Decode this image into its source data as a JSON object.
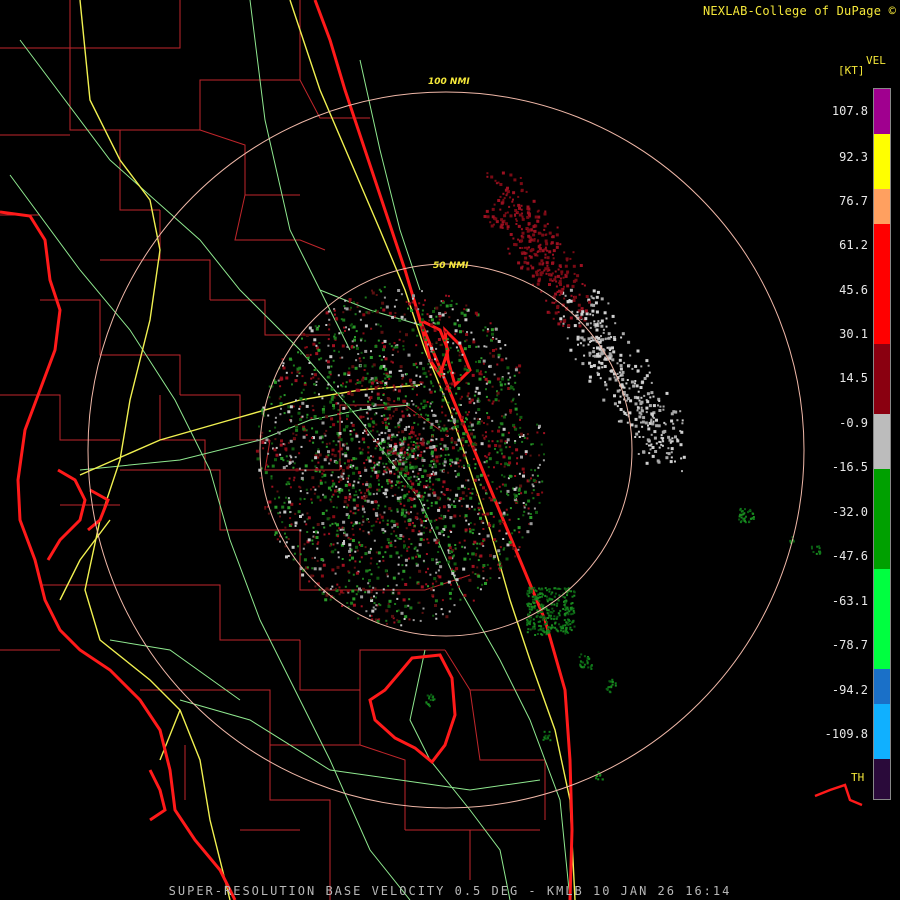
{
  "header": {
    "credit": "NEXLAB-College of DuPage ©"
  },
  "map": {
    "range_rings": [
      {
        "label": "100 NMI"
      },
      {
        "label": "50 NMI"
      }
    ],
    "colors": {
      "background": "#000000",
      "coastline": "#ff1a1a",
      "county_lines": "#c0262b",
      "interstates": "#f0f050",
      "highways": "#8fe88f",
      "range_rings": "#f0b8a8"
    }
  },
  "legend": {
    "product": "VEL",
    "unit": "[KT]",
    "ticks": [
      "107.8",
      "92.3",
      "76.7",
      "61.2",
      "45.6",
      "30.1",
      "14.5",
      "-0.9",
      "-16.5",
      "-32.0",
      "-47.6",
      "-63.1",
      "-78.7",
      "-94.2",
      "-109.8"
    ],
    "threshold_label": "TH",
    "colors": [
      "#a0008f",
      "#ffff00",
      "#ffa060",
      "#ff0000",
      "#8a0010",
      "#bcbcbc",
      "#00a000",
      "#00ff40",
      "#1a70c8",
      "#10b0ff",
      "#2a0a3a"
    ]
  },
  "footer": {
    "caption": "SUPER-RESOLUTION BASE VELOCITY 0.5 DEG - KMLB 10 JAN 26 16:14"
  }
}
